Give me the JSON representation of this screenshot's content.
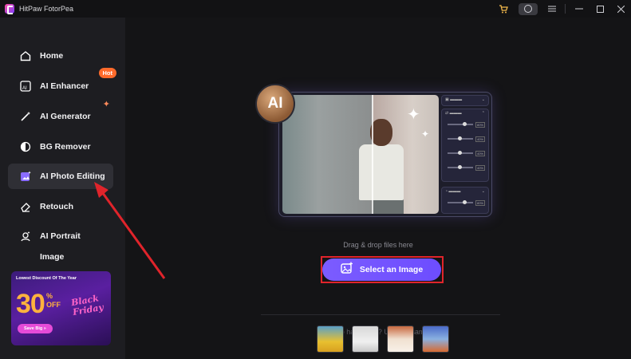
{
  "titlebar": {
    "app_name": "HitPaw FotorPea",
    "icons": [
      "cart-icon",
      "user-icon",
      "menu-icon",
      "minimize-icon",
      "maximize-icon",
      "close-icon"
    ]
  },
  "sidebar": {
    "items": [
      {
        "label": "Home",
        "icon": "home-icon"
      },
      {
        "label": "AI Enhancer",
        "icon": "enhancer-icon",
        "badge": "Hot"
      },
      {
        "label": "AI Generator",
        "icon": "magic-wand-icon"
      },
      {
        "label": "BG Remover",
        "icon": "bg-remover-icon"
      },
      {
        "label": "AI Photo Editing",
        "icon": "photo-edit-icon",
        "active": true
      },
      {
        "label": "Retouch",
        "icon": "eraser-icon"
      },
      {
        "label": "AI Portrait",
        "icon": "portrait-icon"
      },
      {
        "label": "Image",
        "icon": "image-icon"
      }
    ]
  },
  "promo": {
    "headline": "Lowest Discount Of The Year",
    "percent": "30",
    "pct_sign": "%",
    "off": "OFF",
    "black_friday": "Black Friday",
    "cta": "Save Big »"
  },
  "main": {
    "ai_badge": "AI",
    "panel_pct": "80%",
    "panel_pct2": "40%",
    "drag_text": "Drag & drop files here",
    "select_button": "Select an Image",
    "try_text": "Want to have a try? Use our sample.",
    "sample_count": 4
  },
  "colors": {
    "accent": "#6d4dff",
    "hot_badge": "#ff6a2b",
    "annotation": "#e0242b"
  }
}
